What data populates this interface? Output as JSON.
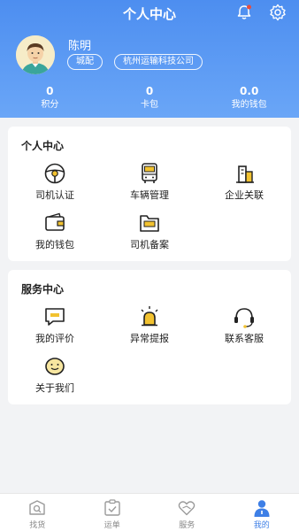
{
  "header": {
    "title": "个人中心",
    "user": {
      "name": "陈明",
      "tags": [
        "城配",
        "杭州运输科技公司"
      ]
    },
    "stats": [
      {
        "value": "0",
        "label": "积分"
      },
      {
        "value": "0",
        "label": "卡包"
      },
      {
        "value": "0.0",
        "label": "我的钱包"
      }
    ]
  },
  "personal_center": {
    "title": "个人中心",
    "items": [
      {
        "label": "司机认证",
        "icon": "steering-wheel-icon"
      },
      {
        "label": "车辆管理",
        "icon": "bus-icon"
      },
      {
        "label": "企业关联",
        "icon": "building-icon"
      },
      {
        "label": "我的钱包",
        "icon": "wallet-icon"
      },
      {
        "label": "司机备案",
        "icon": "folder-icon"
      }
    ]
  },
  "service_center": {
    "title": "服务中心",
    "items": [
      {
        "label": "我的评价",
        "icon": "comment-icon"
      },
      {
        "label": "异常提报",
        "icon": "alarm-icon"
      },
      {
        "label": "联系客服",
        "icon": "headset-icon"
      },
      {
        "label": "关于我们",
        "icon": "smile-icon"
      }
    ]
  },
  "tabbar": {
    "tabs": [
      {
        "label": "找货",
        "icon": "search-goods-icon"
      },
      {
        "label": "运单",
        "icon": "waybill-icon"
      },
      {
        "label": "服务",
        "icon": "service-heart-icon"
      },
      {
        "label": "我的",
        "icon": "profile-icon"
      }
    ],
    "active": "我的"
  },
  "colors": {
    "header_top": "#4d8ef0",
    "header_bottom": "#6aa6f7",
    "accent": "#3e7fe6",
    "icon_highlight": "#f2c230",
    "notification_dot": "#e94b3c"
  }
}
